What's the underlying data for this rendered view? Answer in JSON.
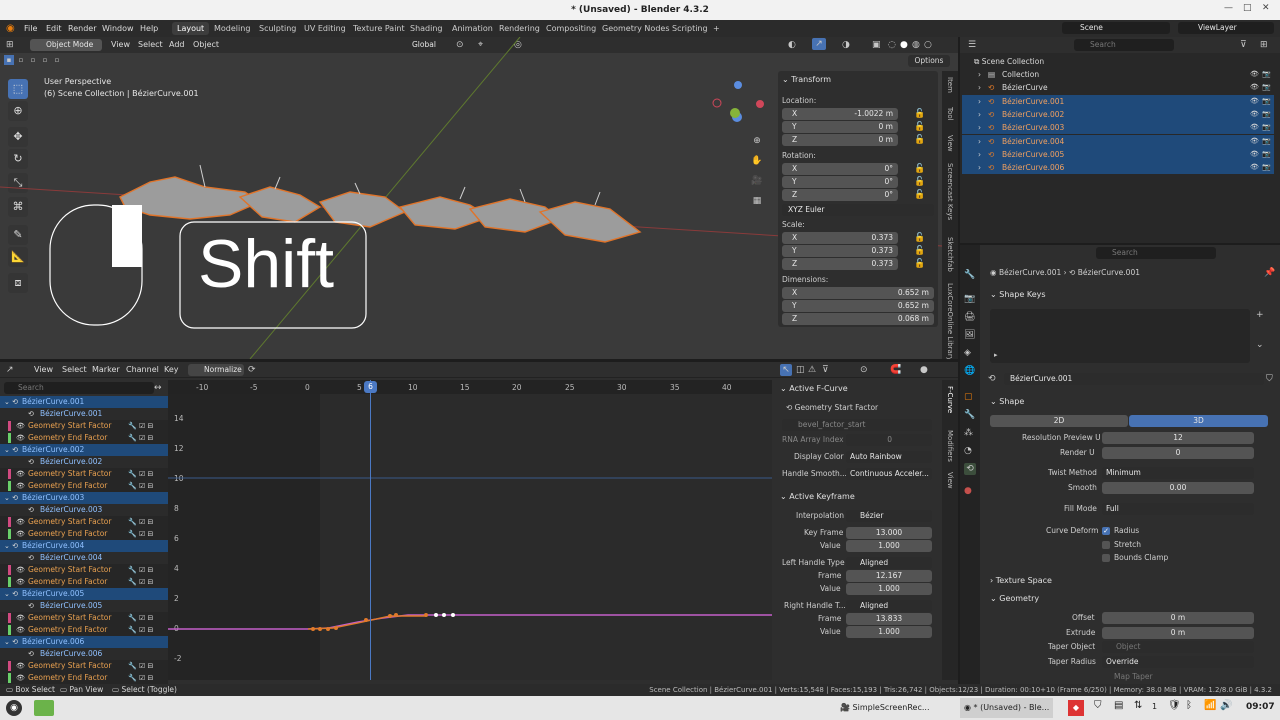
{
  "window": {
    "title": "* (Unsaved) - Blender 4.3.2"
  },
  "menu": [
    "File",
    "Edit",
    "Render",
    "Window",
    "Help"
  ],
  "workspaces": [
    "Layout",
    "Modeling",
    "Sculpting",
    "UV Editing",
    "Texture Paint",
    "Shading",
    "Animation",
    "Rendering",
    "Compositing",
    "Geometry Nodes",
    "Scripting"
  ],
  "workspace_add": "+",
  "scene": "Scene",
  "view_layer": "ViewLayer",
  "viewport": {
    "mode": "Object Mode",
    "menus": [
      "View",
      "Select",
      "Add",
      "Object"
    ],
    "orientation": "Global",
    "options": "Options",
    "perspective": "User Perspective",
    "collection_info": "(6) Scene Collection | BézierCurve.001",
    "key_overlay": "Shift",
    "sidebar_tabs": [
      "Item",
      "Tool",
      "View",
      "Screencast Keys",
      "Sketchfab",
      "LuxCoreOnline Library"
    ]
  },
  "transform": {
    "title": "Transform",
    "location_label": "Location:",
    "location": [
      {
        "axis": "X",
        "value": "-1.0022 m"
      },
      {
        "axis": "Y",
        "value": "0 m"
      },
      {
        "axis": "Z",
        "value": "0 m"
      }
    ],
    "rotation_label": "Rotation:",
    "rotation": [
      {
        "axis": "X",
        "value": "0°"
      },
      {
        "axis": "Y",
        "value": "0°"
      },
      {
        "axis": "Z",
        "value": "0°"
      }
    ],
    "rotation_mode": "XYZ Euler",
    "scale_label": "Scale:",
    "scale": [
      {
        "axis": "X",
        "value": "0.373"
      },
      {
        "axis": "Y",
        "value": "0.373"
      },
      {
        "axis": "Z",
        "value": "0.373"
      }
    ],
    "dimensions_label": "Dimensions:",
    "dimensions": [
      {
        "axis": "X",
        "value": "0.652 m"
      },
      {
        "axis": "Y",
        "value": "0.652 m"
      },
      {
        "axis": "Z",
        "value": "0.068 m"
      }
    ]
  },
  "graph": {
    "menus": [
      "View",
      "Select",
      "Marker",
      "Channel",
      "Key"
    ],
    "normalize": "Normalize",
    "search_placeholder": "Search",
    "frame_ticks": [
      "-10",
      "-5",
      "0",
      "5",
      "10",
      "15",
      "20",
      "25",
      "30",
      "35",
      "40"
    ],
    "current_frame": "6",
    "value_ticks": [
      "14",
      "12",
      "10",
      "8",
      "6",
      "4",
      "2",
      "0",
      "-2"
    ],
    "sidebar_tabs": [
      "F-Curve",
      "Modifiers",
      "View"
    ]
  },
  "channels": [
    {
      "kind": "object",
      "label": "BézierCurve.001"
    },
    {
      "kind": "data",
      "label": "BézierCurve.001"
    },
    {
      "kind": "start",
      "label": "Geometry Start Factor"
    },
    {
      "kind": "end",
      "label": "Geometry End Factor"
    },
    {
      "kind": "object",
      "label": "BézierCurve.002"
    },
    {
      "kind": "data",
      "label": "BézierCurve.002"
    },
    {
      "kind": "start",
      "label": "Geometry Start Factor"
    },
    {
      "kind": "end",
      "label": "Geometry End Factor"
    },
    {
      "kind": "object",
      "label": "BézierCurve.003"
    },
    {
      "kind": "data",
      "label": "BézierCurve.003"
    },
    {
      "kind": "start",
      "label": "Geometry Start Factor"
    },
    {
      "kind": "end",
      "label": "Geometry End Factor"
    },
    {
      "kind": "object",
      "label": "BézierCurve.004"
    },
    {
      "kind": "data",
      "label": "BézierCurve.004"
    },
    {
      "kind": "start",
      "label": "Geometry Start Factor"
    },
    {
      "kind": "end",
      "label": "Geometry End Factor"
    },
    {
      "kind": "object",
      "label": "BézierCurve.005"
    },
    {
      "kind": "data",
      "label": "BézierCurve.005"
    },
    {
      "kind": "start",
      "label": "Geometry Start Factor"
    },
    {
      "kind": "end",
      "label": "Geometry End Factor"
    },
    {
      "kind": "object",
      "label": "BézierCurve.006"
    },
    {
      "kind": "data",
      "label": "BézierCurve.006"
    },
    {
      "kind": "start",
      "label": "Geometry Start Factor"
    },
    {
      "kind": "end",
      "label": "Geometry End Factor"
    }
  ],
  "fcurve": {
    "title": "Active F-Curve",
    "name": "Geometry Start Factor",
    "data_path": "bevel_factor_start",
    "rna_label": "RNA Array Index",
    "rna_value": "0",
    "display_color_label": "Display Color",
    "display_color": "Auto Rainbow",
    "handle_smooth_label": "Handle Smooth...",
    "handle_smooth": "Continuous Acceler..."
  },
  "keyframe": {
    "title": "Active Keyframe",
    "interp_label": "Interpolation",
    "interp": "Bézier",
    "key_frame_label": "Key Frame",
    "key_frame": "13.000",
    "value_label": "Value",
    "value": "1.000",
    "left_type_label": "Left Handle Type",
    "left_type": "Aligned",
    "left_frame_label": "Frame",
    "left_frame": "12.167",
    "left_value_label": "Value",
    "left_value": "1.000",
    "right_type_label": "Right Handle T...",
    "right_type": "Aligned",
    "right_frame_label": "Frame",
    "right_frame": "13.833",
    "right_value_label": "Value",
    "right_value": "1.000"
  },
  "outliner": {
    "search_placeholder": "Search",
    "root": "Scene Collection",
    "items": [
      {
        "label": "Collection",
        "selected": false
      },
      {
        "label": "BézierCurve",
        "selected": false
      },
      {
        "label": "BézierCurve.001",
        "selected": true
      },
      {
        "label": "BézierCurve.002",
        "selected": true
      },
      {
        "label": "BézierCurve.003",
        "selected": true
      },
      {
        "label": "BézierCurve.004",
        "selected": true
      },
      {
        "label": "BézierCurve.005",
        "selected": true
      },
      {
        "label": "BézierCurve.006",
        "selected": true
      }
    ]
  },
  "properties": {
    "search_placeholder": "Search",
    "breadcrumb": [
      "BézierCurve.001",
      "BézierCurve.001"
    ],
    "shape_keys": "Shape Keys",
    "datablock": "BézierCurve.001",
    "shape": "Shape",
    "dim_2d": "2D",
    "dim_3d": "3D",
    "res_preview_label": "Resolution Preview U",
    "res_preview": "12",
    "render_u_label": "Render U",
    "render_u": "0",
    "twist_label": "Twist Method",
    "twist": "Minimum",
    "smooth_label": "Smooth",
    "smooth": "0.00",
    "fill_label": "Fill Mode",
    "fill": "Full",
    "deform_label": "Curve Deform",
    "radius": "Radius",
    "stretch": "Stretch",
    "bounds": "Bounds Clamp",
    "texture_space": "Texture Space",
    "geometry": "Geometry",
    "offset_label": "Offset",
    "offset": "0 m",
    "extrude_label": "Extrude",
    "extrude": "0 m",
    "taper_label": "Taper Object",
    "taper_placeholder": "Object",
    "taper_radius_label": "Taper Radius",
    "taper_radius": "Override",
    "map_taper": "Map Taper"
  },
  "status": {
    "box_select": "Box Select",
    "pan_view": "Pan View",
    "select_toggle": "Select (Toggle)",
    "info": "Scene Collection | BézierCurve.001 | Verts:15,548 | Faces:15,193 | Tris:26,742 | Objects:12/23 | Duration: 00:10+10 (Frame 6/250) | Memory: 38.0 MiB | VRAM: 1.2/8.0 GiB | 4.3.2"
  },
  "taskbar": {
    "app1": "SimpleScreenRec...",
    "app2": "* (Unsaved) - Ble...",
    "num": "1",
    "clock": "09:07"
  },
  "colors": {
    "accent": "#4772b3",
    "selected_row": "#1f4a7a",
    "curve_orange": "#e07a2a",
    "curve_pink": "#c45fc9",
    "playhead": "#4b79c4"
  }
}
